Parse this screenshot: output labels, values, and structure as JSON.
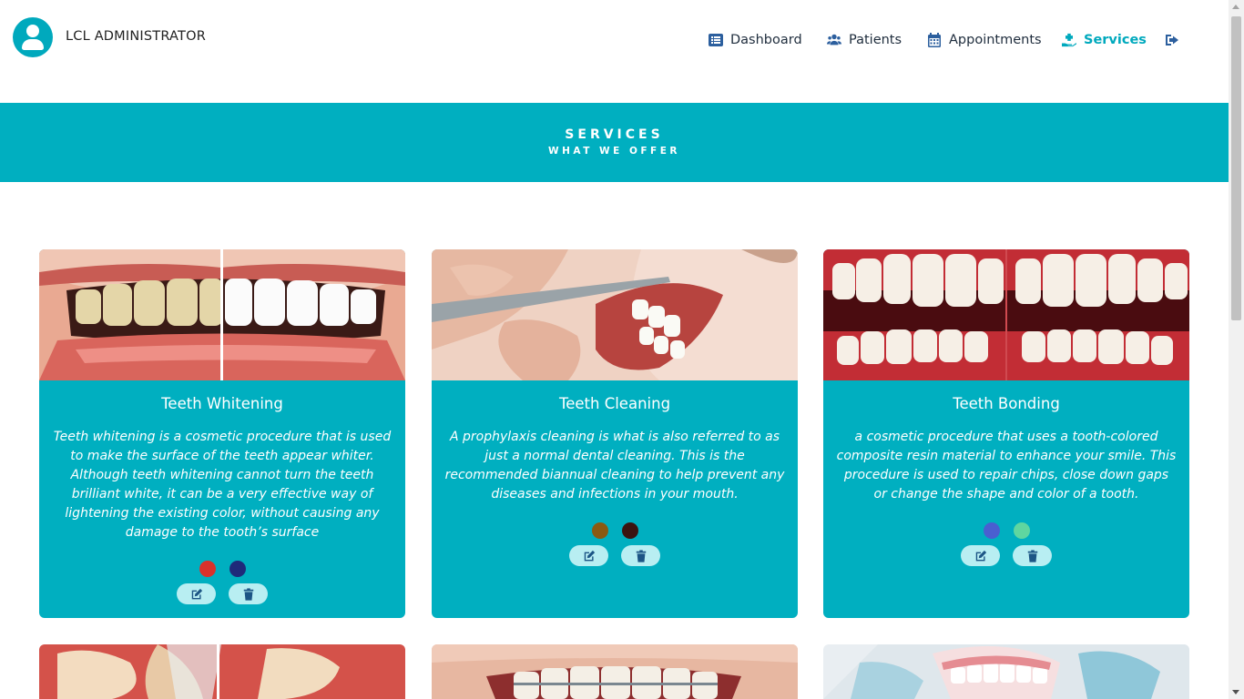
{
  "header": {
    "admin_name": "LCL ADMINISTRATOR",
    "nav": [
      {
        "label": "Dashboard",
        "icon": "list-alt-icon"
      },
      {
        "label": "Patients",
        "icon": "users-icon"
      },
      {
        "label": "Appointments",
        "icon": "calendar-icon"
      },
      {
        "label": "Services",
        "icon": "hand-holding-medical-icon",
        "active": true
      },
      {
        "label": "",
        "icon": "sign-out-icon"
      }
    ]
  },
  "banner": {
    "title": "SERVICES",
    "subtitle": "WHAT WE OFFER"
  },
  "services": [
    {
      "title": "Teeth Whitening",
      "description": "Teeth whitening is a cosmetic procedure that is used to make the surface of the teeth appear whiter. Although teeth whitening cannot turn the teeth brilliant white, it can be a very effective way of lightening the existing color, without causing any damage to the tooth’s surface",
      "colors": [
        "#d9312b",
        "#1f2a7a"
      ]
    },
    {
      "title": "Teeth Cleaning",
      "description": "A prophylaxis cleaning is what is also referred to as just a normal dental cleaning. This is the recommended biannual cleaning to help prevent any diseases and infections in your mouth.",
      "colors": [
        "#8a5a12",
        "#3b1410"
      ]
    },
    {
      "title": "Teeth Bonding",
      "description": "a cosmetic procedure that uses a tooth-colored composite resin material to enhance your smile. This procedure is used to repair chips, close down gaps or change the shape and color of a tooth.",
      "colors": [
        "#4a5fd0",
        "#5fd6a0"
      ]
    }
  ]
}
